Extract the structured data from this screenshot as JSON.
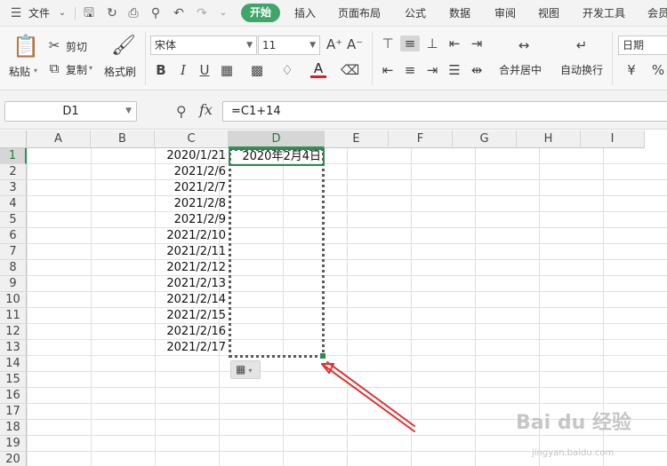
{
  "menubar": {
    "file_label": "文件",
    "tabs": [
      "开始",
      "插入",
      "页面布局",
      "公式",
      "数据",
      "审阅",
      "视图",
      "开发工具",
      "会员"
    ],
    "active_tab": "开始"
  },
  "ribbon": {
    "paste_label": "粘贴",
    "cut_label": "剪切",
    "copy_label": "复制",
    "format_painter_label": "格式刷",
    "font_name": "宋体",
    "font_size": "11",
    "bold": "B",
    "italic": "I",
    "underline": "U",
    "merge_center_label": "合并居中",
    "wrap_text_label": "自动换行",
    "number_format": "日期",
    "currency_symbol": "¥",
    "percent_symbol": "%",
    "font_color": "#e02020"
  },
  "formula_bar": {
    "name_box": "D1",
    "fx": "fx",
    "formula": "=C1+14"
  },
  "sheet": {
    "columns": [
      "A",
      "B",
      "C",
      "D",
      "E",
      "F",
      "G",
      "H",
      "I"
    ],
    "rows": [
      "1",
      "2",
      "3",
      "4",
      "5",
      "6",
      "7",
      "8",
      "9",
      "10",
      "11",
      "12",
      "13",
      "14",
      "15",
      "16",
      "17",
      "18",
      "19",
      "20"
    ],
    "column_c_values": [
      "2020/1/21",
      "2021/2/6",
      "2021/2/7",
      "2021/2/8",
      "2021/2/9",
      "2021/2/10",
      "2021/2/11",
      "2021/2/12",
      "2021/2/13",
      "2021/2/14",
      "2021/2/15",
      "2021/2/16",
      "2021/2/17"
    ],
    "d1_value": "2020年2月4日",
    "selected_column": "D",
    "selected_row": "1"
  },
  "watermark": {
    "text": "Bai du 经验",
    "subtext": "jingyan.baidu.com"
  },
  "colors": {
    "accent": "#3fa66a",
    "selection": "#2e8a4e",
    "arrow": "#e03030"
  }
}
